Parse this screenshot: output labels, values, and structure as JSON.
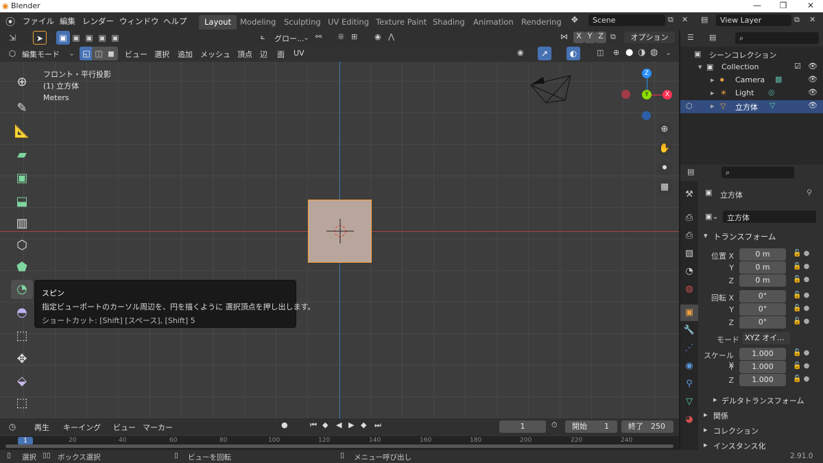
{
  "window": {
    "title": "Blender",
    "minimize": "—",
    "maximize": "❐",
    "close": "✕"
  },
  "menus": [
    "ファイル",
    "編集",
    "レンダー",
    "ウィンドウ",
    "ヘルプ"
  ],
  "workspaces": [
    "Layout",
    "Modeling",
    "Sculpting",
    "UV Editing",
    "Texture Paint",
    "Shading",
    "Animation",
    "Rendering"
  ],
  "active_workspace": "Layout",
  "scene": {
    "name": "Scene",
    "view_layer": "View Layer"
  },
  "toolbar": {
    "transform_orientation": "グロー...",
    "axes": [
      "X",
      "Y",
      "Z"
    ],
    "options": "オプション"
  },
  "viewport_header": {
    "mode": "編集モード",
    "menus": [
      "ビュー",
      "選択",
      "追加",
      "メッシュ",
      "頂点",
      "辺",
      "面",
      "UV"
    ]
  },
  "viewport_info": {
    "line1": "フロント・平行投影",
    "line2": "(1) 立方体",
    "line3": "Meters"
  },
  "gizmo": {
    "z": "Z",
    "y": "Y",
    "x": "X"
  },
  "tooltip": {
    "title": "スピン",
    "description": "指定ビューポートのカーソル周辺を、円を描くように 選択頂点を押し出します。",
    "shortcut": "ショートカット: [Shift] [スペース], [Shift] 5"
  },
  "outliner": {
    "root": "シーンコレクション",
    "collection": "Collection",
    "items": [
      "Camera",
      "Light",
      "立方体"
    ],
    "selected": "立方体"
  },
  "properties": {
    "object_name": "立方体",
    "datablock": "立方体",
    "transform_header": "トランスフォーム",
    "location": {
      "label": "位置 X",
      "x": "0 m",
      "y": "0 m",
      "z": "0 m"
    },
    "rotation": {
      "label": "回転 X",
      "x": "0°",
      "y": "0°",
      "z": "0°"
    },
    "mode_label": "モード",
    "mode_value": "XYZ オイ...",
    "scale": {
      "label": "スケール X",
      "x": "1.000",
      "y": "1.000",
      "z": "1.000"
    },
    "axis_labels": {
      "y": "Y",
      "z": "Z"
    },
    "delta": "デルタトランスフォーム",
    "relations": "関係",
    "collections": "コレクション",
    "instancing": "インスタンス化"
  },
  "timeline": {
    "menus": [
      "再生",
      "キーイング",
      "ビュー",
      "マーカー"
    ],
    "current_frame": "1",
    "start_label": "開始",
    "start": "1",
    "end_label": "終了",
    "end": "250",
    "ruler": [
      "1",
      "20",
      "40",
      "60",
      "80",
      "100",
      "120",
      "140",
      "160",
      "180",
      "200",
      "220",
      "240"
    ]
  },
  "statusbar": {
    "select": "選択",
    "box_select": "ボックス選択",
    "rotate_view": "ビューを回転",
    "menu": "メニュー呼び出し",
    "version": "2.91.0"
  },
  "colors": {
    "accent": "#4772b3",
    "selected_row": "#334d80",
    "x_axis": "#ff3352",
    "y_axis": "#8bdc00",
    "z_axis": "#2890ff",
    "cube_face": "#b8a69c",
    "cube_edge": "#ffa033"
  }
}
